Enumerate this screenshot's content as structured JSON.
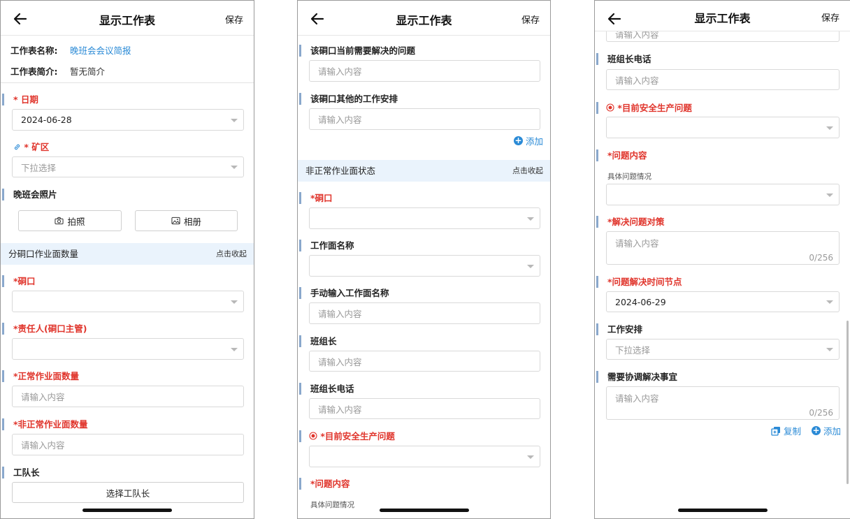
{
  "common": {
    "title": "显示工作表",
    "save": "保存",
    "placeholder": "请输入内容",
    "dropdown": "下拉选择",
    "collapse": "点击收起",
    "add": "添加",
    "copy": "复制",
    "counter": "0/256",
    "detail_hint": "具体问题情况"
  },
  "screen1": {
    "sheet_name_label": "工作表名称:",
    "sheet_name": "晚班会会议简报",
    "sheet_desc_label": "工作表简介:",
    "sheet_desc": "暂无简介",
    "date_label": "日期",
    "date_value": "2024-06-28",
    "mine_label": "矿区",
    "photo_label": "晚班会照片",
    "take_photo": "拍照",
    "album": "相册",
    "section_title": "分硐口作业面数量",
    "adit_label": "*硐口",
    "owner_label": "*责任人(硐口主管)",
    "normal_label": "*正常作业面数量",
    "abnormal_label": "*非正常作业面数量",
    "team_leader_label": "工队长",
    "choose_leader": "选择工队长"
  },
  "screen2": {
    "problem_label": "该硐口当前需要解决的问题",
    "other_label": "该硐口其他的工作安排",
    "section_title": "非正常作业面状态",
    "adit_label": "*硐口",
    "workface_label": "工作面名称",
    "manual_label": "手动输入工作面名称",
    "group_leader_label": "班组长",
    "group_phone_label": "班组长电话",
    "safety_label": "*目前安全生产问题",
    "issue_label": "*问题内容"
  },
  "screen3": {
    "group_phone_label": "班组长电话",
    "safety_label": "*目前安全生产问题",
    "issue_label": "*问题内容",
    "solution_label": "*解决问题对策",
    "deadline_label": "*问题解决时间节点",
    "deadline_value": "2024-06-29",
    "work_label": "工作安排",
    "coord_label": "需要协调解决事宜"
  }
}
